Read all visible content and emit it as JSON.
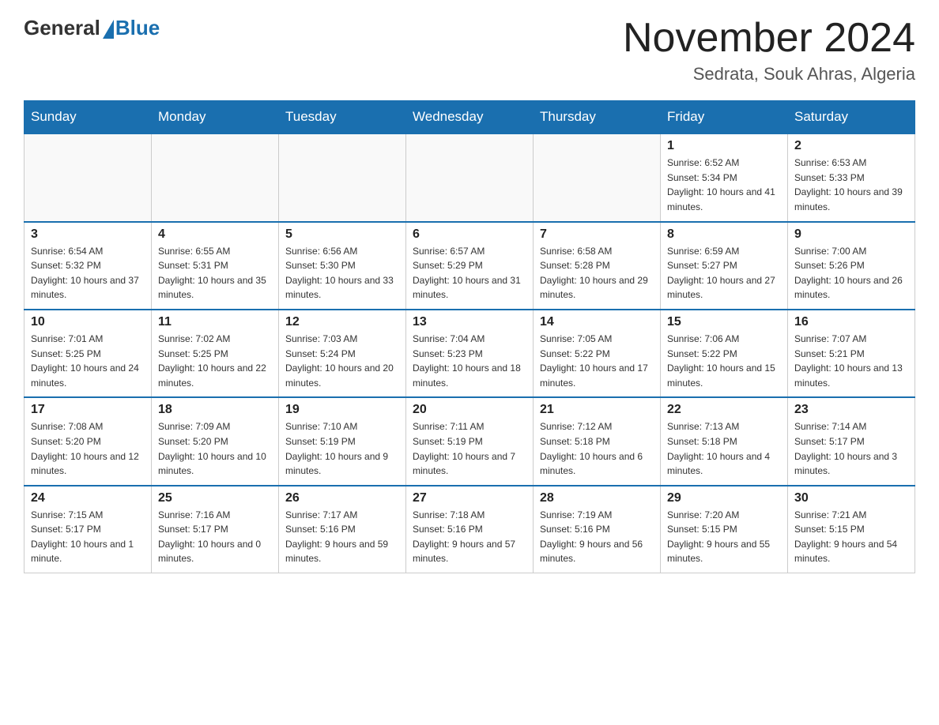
{
  "header": {
    "logo": {
      "general": "General",
      "blue": "Blue"
    },
    "title": "November 2024",
    "location": "Sedrata, Souk Ahras, Algeria"
  },
  "weekdays": [
    "Sunday",
    "Monday",
    "Tuesday",
    "Wednesday",
    "Thursday",
    "Friday",
    "Saturday"
  ],
  "weeks": [
    [
      {
        "day": "",
        "info": ""
      },
      {
        "day": "",
        "info": ""
      },
      {
        "day": "",
        "info": ""
      },
      {
        "day": "",
        "info": ""
      },
      {
        "day": "",
        "info": ""
      },
      {
        "day": "1",
        "info": "Sunrise: 6:52 AM\nSunset: 5:34 PM\nDaylight: 10 hours and 41 minutes."
      },
      {
        "day": "2",
        "info": "Sunrise: 6:53 AM\nSunset: 5:33 PM\nDaylight: 10 hours and 39 minutes."
      }
    ],
    [
      {
        "day": "3",
        "info": "Sunrise: 6:54 AM\nSunset: 5:32 PM\nDaylight: 10 hours and 37 minutes."
      },
      {
        "day": "4",
        "info": "Sunrise: 6:55 AM\nSunset: 5:31 PM\nDaylight: 10 hours and 35 minutes."
      },
      {
        "day": "5",
        "info": "Sunrise: 6:56 AM\nSunset: 5:30 PM\nDaylight: 10 hours and 33 minutes."
      },
      {
        "day": "6",
        "info": "Sunrise: 6:57 AM\nSunset: 5:29 PM\nDaylight: 10 hours and 31 minutes."
      },
      {
        "day": "7",
        "info": "Sunrise: 6:58 AM\nSunset: 5:28 PM\nDaylight: 10 hours and 29 minutes."
      },
      {
        "day": "8",
        "info": "Sunrise: 6:59 AM\nSunset: 5:27 PM\nDaylight: 10 hours and 27 minutes."
      },
      {
        "day": "9",
        "info": "Sunrise: 7:00 AM\nSunset: 5:26 PM\nDaylight: 10 hours and 26 minutes."
      }
    ],
    [
      {
        "day": "10",
        "info": "Sunrise: 7:01 AM\nSunset: 5:25 PM\nDaylight: 10 hours and 24 minutes."
      },
      {
        "day": "11",
        "info": "Sunrise: 7:02 AM\nSunset: 5:25 PM\nDaylight: 10 hours and 22 minutes."
      },
      {
        "day": "12",
        "info": "Sunrise: 7:03 AM\nSunset: 5:24 PM\nDaylight: 10 hours and 20 minutes."
      },
      {
        "day": "13",
        "info": "Sunrise: 7:04 AM\nSunset: 5:23 PM\nDaylight: 10 hours and 18 minutes."
      },
      {
        "day": "14",
        "info": "Sunrise: 7:05 AM\nSunset: 5:22 PM\nDaylight: 10 hours and 17 minutes."
      },
      {
        "day": "15",
        "info": "Sunrise: 7:06 AM\nSunset: 5:22 PM\nDaylight: 10 hours and 15 minutes."
      },
      {
        "day": "16",
        "info": "Sunrise: 7:07 AM\nSunset: 5:21 PM\nDaylight: 10 hours and 13 minutes."
      }
    ],
    [
      {
        "day": "17",
        "info": "Sunrise: 7:08 AM\nSunset: 5:20 PM\nDaylight: 10 hours and 12 minutes."
      },
      {
        "day": "18",
        "info": "Sunrise: 7:09 AM\nSunset: 5:20 PM\nDaylight: 10 hours and 10 minutes."
      },
      {
        "day": "19",
        "info": "Sunrise: 7:10 AM\nSunset: 5:19 PM\nDaylight: 10 hours and 9 minutes."
      },
      {
        "day": "20",
        "info": "Sunrise: 7:11 AM\nSunset: 5:19 PM\nDaylight: 10 hours and 7 minutes."
      },
      {
        "day": "21",
        "info": "Sunrise: 7:12 AM\nSunset: 5:18 PM\nDaylight: 10 hours and 6 minutes."
      },
      {
        "day": "22",
        "info": "Sunrise: 7:13 AM\nSunset: 5:18 PM\nDaylight: 10 hours and 4 minutes."
      },
      {
        "day": "23",
        "info": "Sunrise: 7:14 AM\nSunset: 5:17 PM\nDaylight: 10 hours and 3 minutes."
      }
    ],
    [
      {
        "day": "24",
        "info": "Sunrise: 7:15 AM\nSunset: 5:17 PM\nDaylight: 10 hours and 1 minute."
      },
      {
        "day": "25",
        "info": "Sunrise: 7:16 AM\nSunset: 5:17 PM\nDaylight: 10 hours and 0 minutes."
      },
      {
        "day": "26",
        "info": "Sunrise: 7:17 AM\nSunset: 5:16 PM\nDaylight: 9 hours and 59 minutes."
      },
      {
        "day": "27",
        "info": "Sunrise: 7:18 AM\nSunset: 5:16 PM\nDaylight: 9 hours and 57 minutes."
      },
      {
        "day": "28",
        "info": "Sunrise: 7:19 AM\nSunset: 5:16 PM\nDaylight: 9 hours and 56 minutes."
      },
      {
        "day": "29",
        "info": "Sunrise: 7:20 AM\nSunset: 5:15 PM\nDaylight: 9 hours and 55 minutes."
      },
      {
        "day": "30",
        "info": "Sunrise: 7:21 AM\nSunset: 5:15 PM\nDaylight: 9 hours and 54 minutes."
      }
    ]
  ]
}
